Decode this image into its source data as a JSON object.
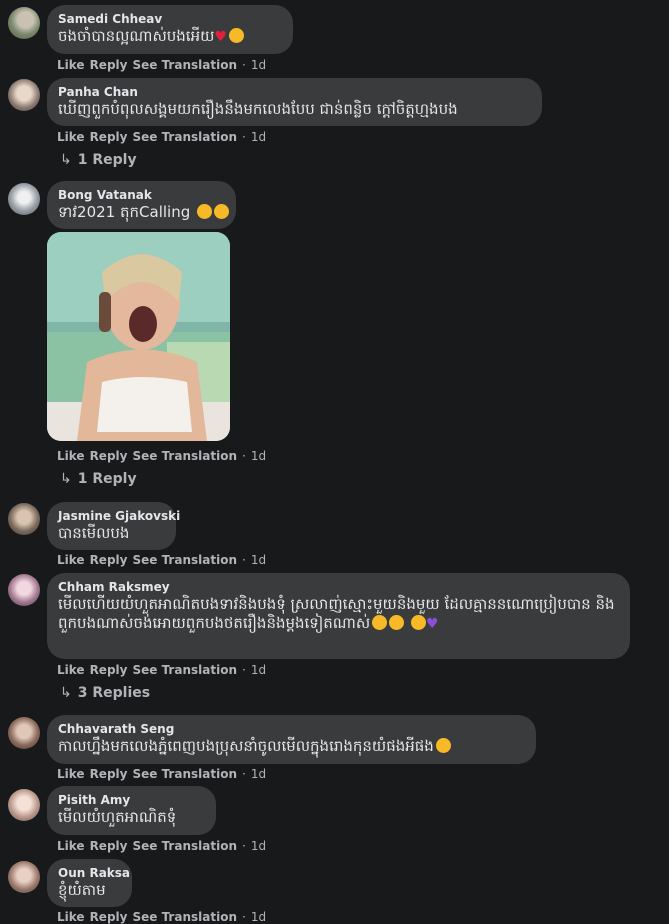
{
  "comments": [
    {
      "name": "Samedi Chheav",
      "text": "ចងចាំបានល្អណាស់បងអើយ",
      "actions": {
        "like": "Like",
        "reply": "Reply",
        "translate": "See Translation",
        "time": "1d"
      }
    },
    {
      "name": "Panha Chan",
      "text": "ឃើញពួកបំពុលសង្គមយករឿងនឹងមកលេងបែប ជាន់ពន្លិច ក្តៅចិត្តហ្មងបង",
      "actions": {
        "like": "Like",
        "reply": "Reply",
        "translate": "See Translation",
        "time": "1d"
      },
      "replies": "1 Reply"
    },
    {
      "name": "Bong Vatanak",
      "text": "ទាវ2021 តុកCalling",
      "actions": {
        "like": "Like",
        "reply": "Reply",
        "translate": "See Translation",
        "time": "1d"
      },
      "replies": "1 Reply"
    },
    {
      "name": "Jasmine Gjakovski",
      "text": "បានមើលបង",
      "actions": {
        "like": "Like",
        "reply": "Reply",
        "translate": "See Translation",
        "time": "1d"
      }
    },
    {
      "name": "Chham Raksmey",
      "text": "មើលហើយយំហួតអាណិតបងទាវនិងបងទុំ ស្រលាញ់ស្មោះមួយនិងមួយ ដែលគ្មាននណោប្រៀបបាន និងពួកបងណាស់ចង់អោយពួកបងថតរឿងនិងម្តងទៀតណាស់",
      "actions": {
        "like": "Like",
        "reply": "Reply",
        "translate": "See Translation",
        "time": "1d"
      },
      "replies": "3 Replies"
    },
    {
      "name": "Chhavarath Seng",
      "text": "កាលហ្នឹងមកលេងភ្នំពេញបងប្រុសនាំចូលមើលក្នុងរោងកុនយំផងអីផង",
      "actions": {
        "like": "Like",
        "reply": "Reply",
        "translate": "See Translation",
        "time": "1d"
      }
    },
    {
      "name": "Pisith Amy",
      "text": "មើលយំហួតអាណិតទុំ",
      "actions": {
        "like": "Like",
        "reply": "Reply",
        "translate": "See Translation",
        "time": "1d"
      }
    },
    {
      "name": "Oun Raksa",
      "text": "ខ្ញុំយំតាម",
      "actions": {
        "like": "Like",
        "reply": "Reply",
        "translate": "See Translation",
        "time": "1d"
      }
    }
  ],
  "colors": {
    "background": "#18191a",
    "bubble": "#3a3b3c",
    "text": "#e4e6eb",
    "muted": "#b0b3b8"
  },
  "icons": {
    "reply_arrow": "reply-arrow-icon",
    "emoji": "emoji-icon"
  }
}
